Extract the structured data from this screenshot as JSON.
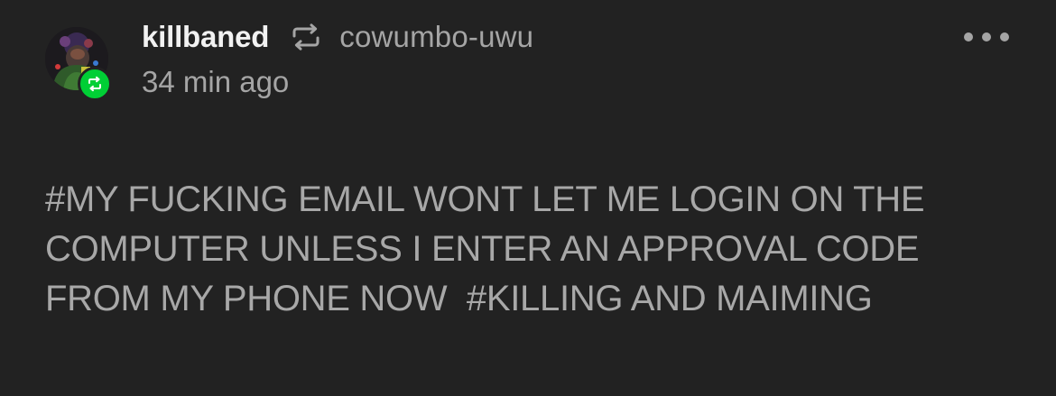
{
  "post": {
    "author": "killbaned",
    "reblogged_from": "cowumbo-uwu",
    "timestamp": "34 min ago",
    "tags": [
      "#MY FUCKING EMAIL WONT LET ME LOGIN ON THE COMPUTER UNLESS I ENTER AN APPROVAL CODE FROM MY PHONE NOW",
      "#KILLING AND MAIMING"
    ]
  },
  "icons": {
    "avatar": "user-avatar",
    "badge": "reblog-icon",
    "header_reblog": "reblog-icon",
    "more": "more-options-icon"
  },
  "colors": {
    "background": "#222222",
    "badge_green": "#00cf35",
    "secondary_text": "#a5a5a5",
    "primary_text": "#f2f2f2"
  }
}
